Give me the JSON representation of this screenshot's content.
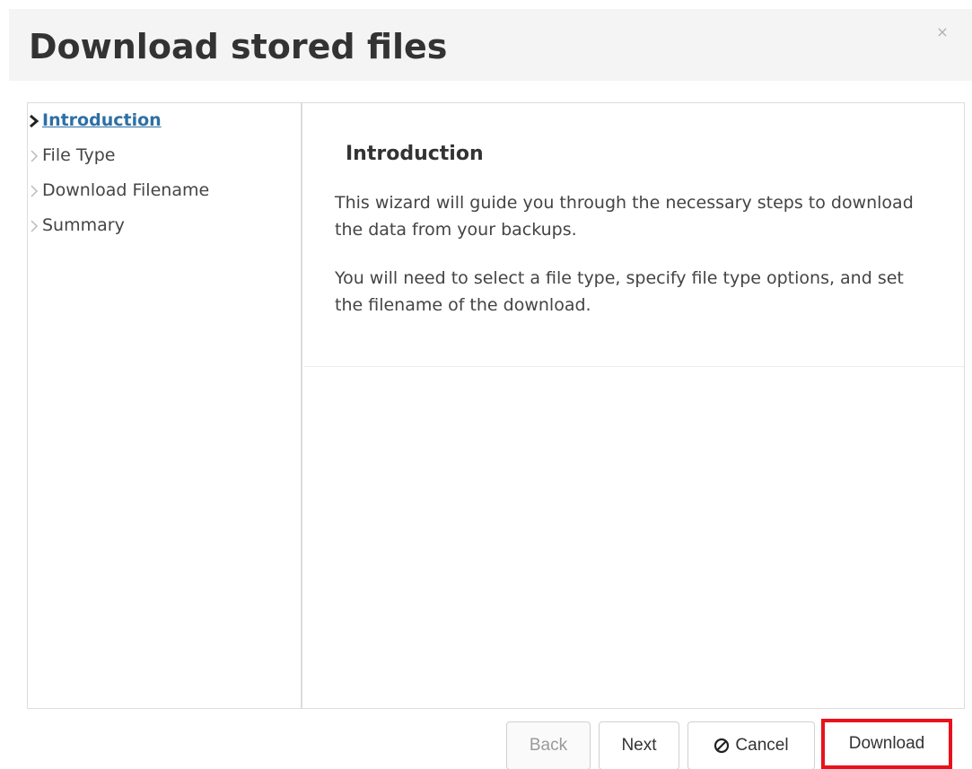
{
  "dialog": {
    "title": "Download stored files",
    "close_glyph": "×"
  },
  "steps": [
    {
      "label": "Introduction",
      "active": true
    },
    {
      "label": "File Type",
      "active": false
    },
    {
      "label": "Download Filename",
      "active": false
    },
    {
      "label": "Summary",
      "active": false
    }
  ],
  "content": {
    "title": "Introduction",
    "paragraph1": "This wizard will guide you through the necessary steps to download the data from your backups.",
    "paragraph2": "You will need to select a file type, specify file type options, and set the filename of the download."
  },
  "buttons": {
    "back": "Back",
    "next": "Next",
    "cancel": "Cancel",
    "download": "Download"
  },
  "colors": {
    "active_step": "#2d6fa5",
    "highlight_border": "#e8121b",
    "header_bg": "#f4f4f4"
  },
  "icons": {
    "step_marker": "chevron-right-icon",
    "cancel": "ban-icon",
    "close": "close-icon"
  }
}
